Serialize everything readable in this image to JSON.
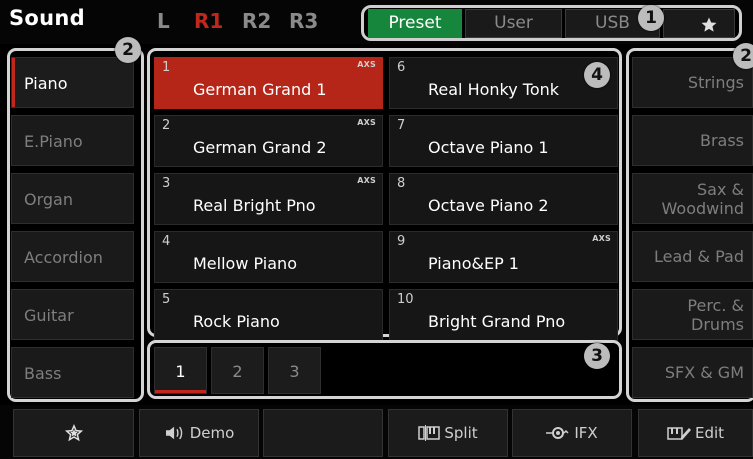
{
  "header": {
    "title": "Sound",
    "parts": [
      {
        "label": "L",
        "active": false
      },
      {
        "label": "R1",
        "active": true
      },
      {
        "label": "R2",
        "active": false
      },
      {
        "label": "R3",
        "active": false
      }
    ],
    "source_tabs": [
      {
        "label": "Preset",
        "active": true
      },
      {
        "label": "User",
        "active": false
      },
      {
        "label": "USB",
        "active": false
      }
    ],
    "favorite_icon": "star-icon"
  },
  "callouts": [
    "1",
    "2",
    "2",
    "3",
    "4"
  ],
  "left_categories": [
    {
      "label": "Piano",
      "active": true
    },
    {
      "label": "E.Piano",
      "active": false
    },
    {
      "label": "Organ",
      "active": false
    },
    {
      "label": "Accordion",
      "active": false
    },
    {
      "label": "Guitar",
      "active": false
    },
    {
      "label": "Bass",
      "active": false
    }
  ],
  "voices": [
    {
      "num": "1",
      "name": "German Grand 1",
      "axs": "AXS",
      "active": true
    },
    {
      "num": "6",
      "name": "Real Honky Tonk",
      "axs": "",
      "active": false
    },
    {
      "num": "2",
      "name": "German Grand 2",
      "axs": "AXS",
      "active": false
    },
    {
      "num": "7",
      "name": "Octave Piano 1",
      "axs": "",
      "active": false
    },
    {
      "num": "3",
      "name": "Real Bright Pno",
      "axs": "AXS",
      "active": false
    },
    {
      "num": "8",
      "name": "Octave Piano 2",
      "axs": "",
      "active": false
    },
    {
      "num": "4",
      "name": "Mellow Piano",
      "axs": "",
      "active": false
    },
    {
      "num": "9",
      "name": "Piano&EP 1",
      "axs": "AXS",
      "active": false
    },
    {
      "num": "5",
      "name": "Rock Piano",
      "axs": "",
      "active": false
    },
    {
      "num": "10",
      "name": "Bright Grand Pno",
      "axs": "",
      "active": false
    }
  ],
  "pages": [
    {
      "label": "1",
      "active": true
    },
    {
      "label": "2",
      "active": false
    },
    {
      "label": "3",
      "active": false
    }
  ],
  "right_categories": [
    {
      "label": "Strings"
    },
    {
      "label": "Brass"
    },
    {
      "label": "Sax &\nWoodwind"
    },
    {
      "label": "Lead & Pad"
    },
    {
      "label": "Perc. &\nDrums"
    },
    {
      "label": "SFX & GM"
    }
  ],
  "bottom_bar": {
    "favorite_icon": "star-outline-icon",
    "demo_label": "Demo",
    "split_label": "Split",
    "ifx_label": "IFX",
    "edit_label": "Edit"
  },
  "colors": {
    "accent_red": "#c0281c",
    "tile_selected": "#b52518",
    "tab_green": "#17863d",
    "callout_gray": "#bcbcbc"
  }
}
